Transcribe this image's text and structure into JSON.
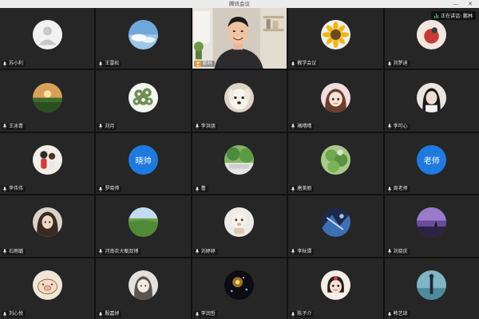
{
  "window": {
    "title": "腾讯会议",
    "minimize_glyph": "—",
    "close_glyph": "✕"
  },
  "speaking_indicator": {
    "label": "正在讲话: 鹏林"
  },
  "participants": [
    {
      "name": "苏小利",
      "avatar": "default-person"
    },
    {
      "name": "王雷松",
      "avatar": "blue-sky"
    },
    {
      "name": "鹏林",
      "avatar": "live-video"
    },
    {
      "name": "教学会议",
      "avatar": "sunflower"
    },
    {
      "name": "刘梦迪",
      "avatar": "red-dot"
    },
    {
      "name": "王冰青",
      "avatar": "sunset-field"
    },
    {
      "name": "刘月",
      "avatar": "white-flowers"
    },
    {
      "name": "李洪朋",
      "avatar": "white-dog"
    },
    {
      "name": "褚晴晴",
      "avatar": "anime-girl"
    },
    {
      "name": "李可心",
      "avatar": "portrait-girl"
    },
    {
      "name": "李伟伟",
      "avatar": "cartoon-couple"
    },
    {
      "name": "罗晓帅",
      "avatar": "text",
      "avatar_text": "晓帅"
    },
    {
      "name": "蕾",
      "avatar": "green-scene"
    },
    {
      "name": "唐美丽",
      "avatar": "green-plant"
    },
    {
      "name": "周老师",
      "avatar": "text",
      "avatar_text": "老师"
    },
    {
      "name": "石雨璐",
      "avatar": "dark-hair-girl"
    },
    {
      "name": "河南农大甄双博",
      "avatar": "green-landscape"
    },
    {
      "name": "刘婷婷",
      "avatar": "cartoon-light"
    },
    {
      "name": "李秋谭",
      "avatar": "blue-art"
    },
    {
      "name": "刘晓庆",
      "avatar": "purple-sky"
    },
    {
      "name": "刘心悦",
      "avatar": "pig-sketch"
    },
    {
      "name": "殷嘉妤",
      "avatar": "sketch-girl"
    },
    {
      "name": "李润哲",
      "avatar": "night-lights"
    },
    {
      "name": "陈子介",
      "avatar": "cute-child"
    },
    {
      "name": "韩艺琼",
      "avatar": "teal-figure"
    }
  ],
  "colors": {
    "tile_bg": "#262626",
    "grid_gap": "#111111",
    "blue_avatar": "#1f7ae0",
    "speaking_green": "#3ad07a",
    "host_badge": "#f29a2e"
  }
}
